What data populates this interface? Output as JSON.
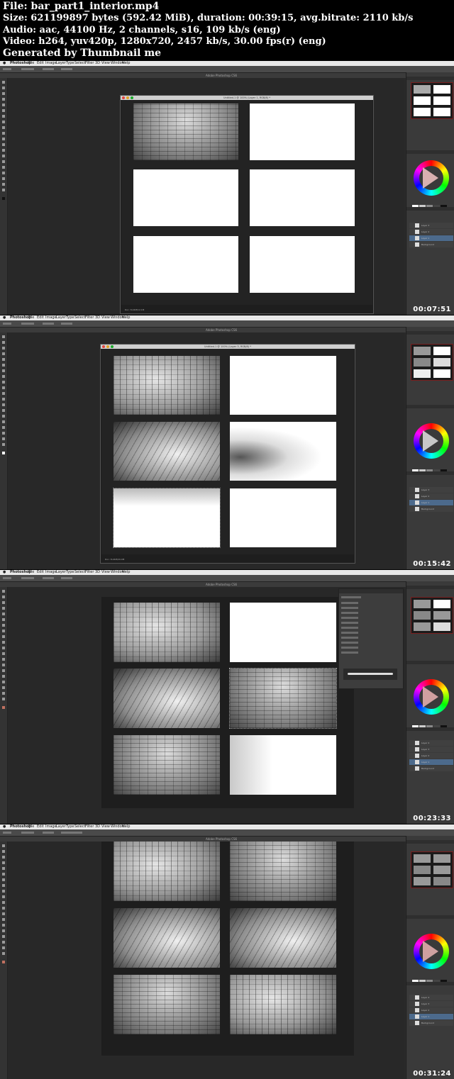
{
  "header": {
    "file_line": "File: bar_part1_interior.mp4",
    "size_line": "Size: 621199897 bytes (592.42 MiB), duration: 00:39:15, avg.bitrate: 2110 kb/s",
    "audio_line": "Audio: aac, 44100 Hz, 2 channels, s16, 109 kb/s (eng)",
    "video_line": "Video: h264, yuv420p, 1280x720, 2457 kb/s, 30.00 fps(r) (eng)",
    "generator_line": "Generated by Thumbnail me"
  },
  "app": {
    "name": "Photoshop",
    "window_title": "Adobe Photoshop CS6",
    "menu": [
      "File",
      "Edit",
      "Image",
      "Layer",
      "Type",
      "Select",
      "Filter",
      "3D",
      "View",
      "Window",
      "Help"
    ]
  },
  "frames": [
    {
      "timestamp": "00:07:51",
      "doc_title": "Untitled-1 @ 100% (Layer 1, RGB/8) *",
      "status": "Doc: 8.24M/12.1M"
    },
    {
      "timestamp": "00:15:42",
      "doc_title": "Untitled-1 @ 100% (Layer 3, RGB/8) *",
      "status": "Doc: 8.24M/20.4M"
    },
    {
      "timestamp": "00:23:33",
      "doc_title": "",
      "status": ""
    },
    {
      "timestamp": "00:31:24",
      "doc_title": "",
      "status": ""
    }
  ],
  "layers_panel": {
    "items": [
      "Layer 4",
      "Layer 3",
      "Layer 2",
      "Layer 1",
      "Background"
    ]
  },
  "colors": {
    "menubar": "#e9e9e9",
    "workspace": "#282828",
    "panel_bg": "#3a3a3a",
    "selection_accent": "#7a1f1f"
  }
}
